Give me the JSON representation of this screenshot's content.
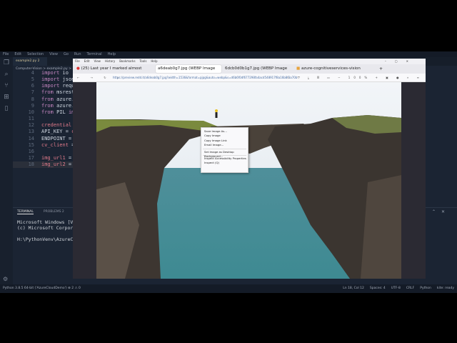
{
  "vscode": {
    "menu": [
      "File",
      "Edit",
      "Selection",
      "View",
      "Go",
      "Run",
      "Terminal",
      "Help"
    ],
    "activity_icons": [
      "files-icon",
      "search-icon",
      "source-control-icon",
      "extensions-icon",
      "bookmark-icon"
    ],
    "tab": "example2.py 2",
    "breadcrumb": "Computer-Vision > example2.py >",
    "code": [
      {
        "n": "4",
        "parts": [
          [
            "kw",
            "import"
          ],
          [
            "tx",
            " io"
          ]
        ]
      },
      {
        "n": "5",
        "parts": [
          [
            "kw",
            "import"
          ],
          [
            "tx",
            " json"
          ]
        ]
      },
      {
        "n": "6",
        "parts": [
          [
            "kw",
            "import"
          ],
          [
            "tx",
            " request"
          ]
        ]
      },
      {
        "n": "7",
        "parts": [
          [
            "kw",
            "from"
          ],
          [
            "tx",
            " msrest.au"
          ]
        ]
      },
      {
        "n": "8",
        "parts": [
          [
            "kw",
            "from"
          ],
          [
            "tx",
            " azure.cog"
          ]
        ]
      },
      {
        "n": "9",
        "parts": [
          [
            "kw",
            "from"
          ],
          [
            "tx",
            " azure.cog"
          ]
        ]
      },
      {
        "n": "10",
        "parts": [
          [
            "kw",
            "from"
          ],
          [
            "tx",
            " PIL "
          ],
          [
            "kw",
            "impor"
          ]
        ]
      },
      {
        "n": "11",
        "parts": []
      },
      {
        "n": "12",
        "parts": [
          [
            "vn",
            "credential"
          ],
          [
            "tx",
            " = j"
          ]
        ]
      },
      {
        "n": "13",
        "parts": [
          [
            "tx",
            "API_KEY = "
          ],
          [
            "vn",
            "cred"
          ]
        ]
      },
      {
        "n": "14",
        "parts": [
          [
            "tx",
            "ENDPOINT = "
          ],
          [
            "vn",
            "cre"
          ]
        ]
      },
      {
        "n": "15",
        "parts": [
          [
            "vn",
            "cv_client"
          ],
          [
            "tx",
            " = Co"
          ]
        ]
      },
      {
        "n": "16",
        "parts": []
      },
      {
        "n": "17",
        "parts": [
          [
            "vn",
            "img_url1"
          ],
          [
            "tx",
            " ="
          ]
        ]
      },
      {
        "n": "18",
        "parts": [
          [
            "vn",
            "img_url2"
          ],
          [
            "tx",
            " ="
          ]
        ]
      }
    ],
    "panel_tabs": [
      "TERMINAL",
      "PROBLEMS  2",
      "DEBUG C"
    ],
    "terminal": "Microsoft Windows [Ver\n(c) Microsoft Corporat\n\nH:\\PythonVenv\\AzureClo",
    "status_left": "Python 3.8.5 64-bit ('AzureCloudDemo')   ⊗ 2 ⚠ 0",
    "status_right": [
      "Ln 18, Col 12",
      "Spaces: 4",
      "UTF-8",
      "CRLF",
      "Python",
      "kite: ready"
    ]
  },
  "firefox": {
    "menu": [
      "File",
      "Edit",
      "View",
      "History",
      "Bookmarks",
      "Tools",
      "Help"
    ],
    "tabs": [
      "(25) Last year I marked almost",
      "a6deab0g7.jpg (WEBP Image",
      "6dcb0d0b1g7.jpg (WEBP Image",
      "azure-cognitiveservices-vision"
    ],
    "url": "https://preview.redd.it/a6deab0g7.jpg?width=1536&format=pjpg&auto=webp&s=d6b6f0df677298fa4acd548917f8a16b8f3a70b",
    "zoom": "100%",
    "context_menu": [
      "Save Image As…",
      "Copy Image",
      "Copy Image Link",
      "Email Image…",
      "Set Image as Desktop Background…",
      "Inspect Accessibility Properties",
      "Inspect (Q)"
    ]
  },
  "colors": {
    "vscode_bg": "#1b2433",
    "firefox_chrome": "#f0f0f4",
    "accent": "#0060df"
  }
}
